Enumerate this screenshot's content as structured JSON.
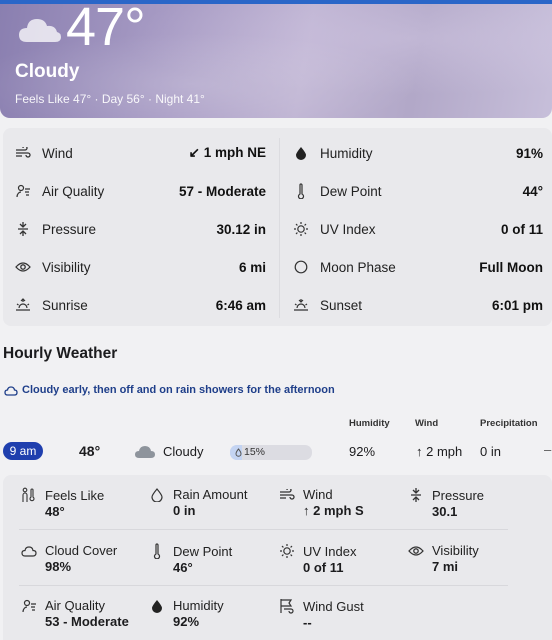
{
  "current": {
    "temperature": "47°",
    "condition": "Cloudy",
    "feels_line": "Feels Like 47° · Day 56° · Night 41°"
  },
  "details": {
    "left": [
      {
        "icon": "wind-icon",
        "label": "Wind",
        "value": "↙ 1 mph NE"
      },
      {
        "icon": "air-quality-icon",
        "label": "Air Quality",
        "value": "57 - Moderate"
      },
      {
        "icon": "pressure-icon",
        "label": "Pressure",
        "value": "30.12 in"
      },
      {
        "icon": "eye-icon",
        "label": "Visibility",
        "value": "6 mi"
      },
      {
        "icon": "sunrise-icon",
        "label": "Sunrise",
        "value": "6:46 am"
      }
    ],
    "right": [
      {
        "icon": "humidity-drop-icon",
        "label": "Humidity",
        "value": "91%"
      },
      {
        "icon": "thermometer-icon",
        "label": "Dew Point",
        "value": "44°"
      },
      {
        "icon": "sun-icon",
        "label": "UV Index",
        "value": "0 of 11"
      },
      {
        "icon": "moon-icon",
        "label": "Moon Phase",
        "value": "Full Moon"
      },
      {
        "icon": "sunset-icon",
        "label": "Sunset",
        "value": "6:01 pm"
      }
    ]
  },
  "hourly": {
    "title": "Hourly Weather",
    "forecast_text": "Cloudy early, then off and on rain showers for the afternoon",
    "columns": {
      "humidity": "Humidity",
      "wind": "Wind",
      "precipitation": "Precipitation"
    },
    "row": {
      "time": "9 am",
      "temp": "48°",
      "condition": "Cloudy",
      "precip_chance": "15%",
      "precip_fraction": 0.15,
      "humidity": "92%",
      "wind": "↑ 2 mph",
      "precipitation": "0 in",
      "more": "–"
    },
    "expanded": [
      {
        "icon": "feels-like-icon",
        "label": "Feels Like",
        "value": "48°"
      },
      {
        "icon": "rain-drop-icon",
        "label": "Rain Amount",
        "value": "0 in"
      },
      {
        "icon": "wind-icon",
        "label": "Wind",
        "value": "↑ 2 mph S"
      },
      {
        "icon": "pressure-icon",
        "label": "Pressure",
        "value": "30.1"
      },
      {
        "icon": "cloud-icon",
        "label": "Cloud Cover",
        "value": "98%"
      },
      {
        "icon": "thermometer-icon",
        "label": "Dew Point",
        "value": "46°"
      },
      {
        "icon": "sun-icon",
        "label": "UV Index",
        "value": "0 of 11"
      },
      {
        "icon": "eye-icon",
        "label": "Visibility",
        "value": "7 mi"
      },
      {
        "icon": "air-quality-icon",
        "label": "Air Quality",
        "value": "53 - Moderate"
      },
      {
        "icon": "humidity-drop-icon",
        "label": "Humidity",
        "value": "92%"
      },
      {
        "icon": "wind-gust-icon",
        "label": "Wind Gust",
        "value": "--"
      }
    ]
  },
  "colors": {
    "accent": "#1f3fae",
    "header_bar": "#2a66c8",
    "forecast_text": "#1f3f8a"
  }
}
